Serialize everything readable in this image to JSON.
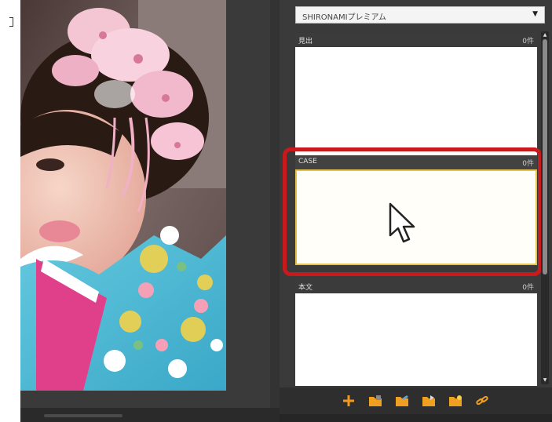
{
  "dropdown": {
    "value": "SHIRONAMIプレミアム"
  },
  "sections": [
    {
      "title": "見出",
      "count": "0件"
    },
    {
      "title": "CASE",
      "count": "0件"
    },
    {
      "title": "本文",
      "count": "0件"
    }
  ],
  "toolbar": {
    "icons": [
      "add-icon",
      "folder-icon",
      "folder-edit-icon",
      "folder-move-icon",
      "folder-settings-icon",
      "link-icon"
    ]
  },
  "colors": {
    "highlight": "#c8191d",
    "accent": "#f0a020",
    "panel_bg": "#3a3a3a"
  }
}
